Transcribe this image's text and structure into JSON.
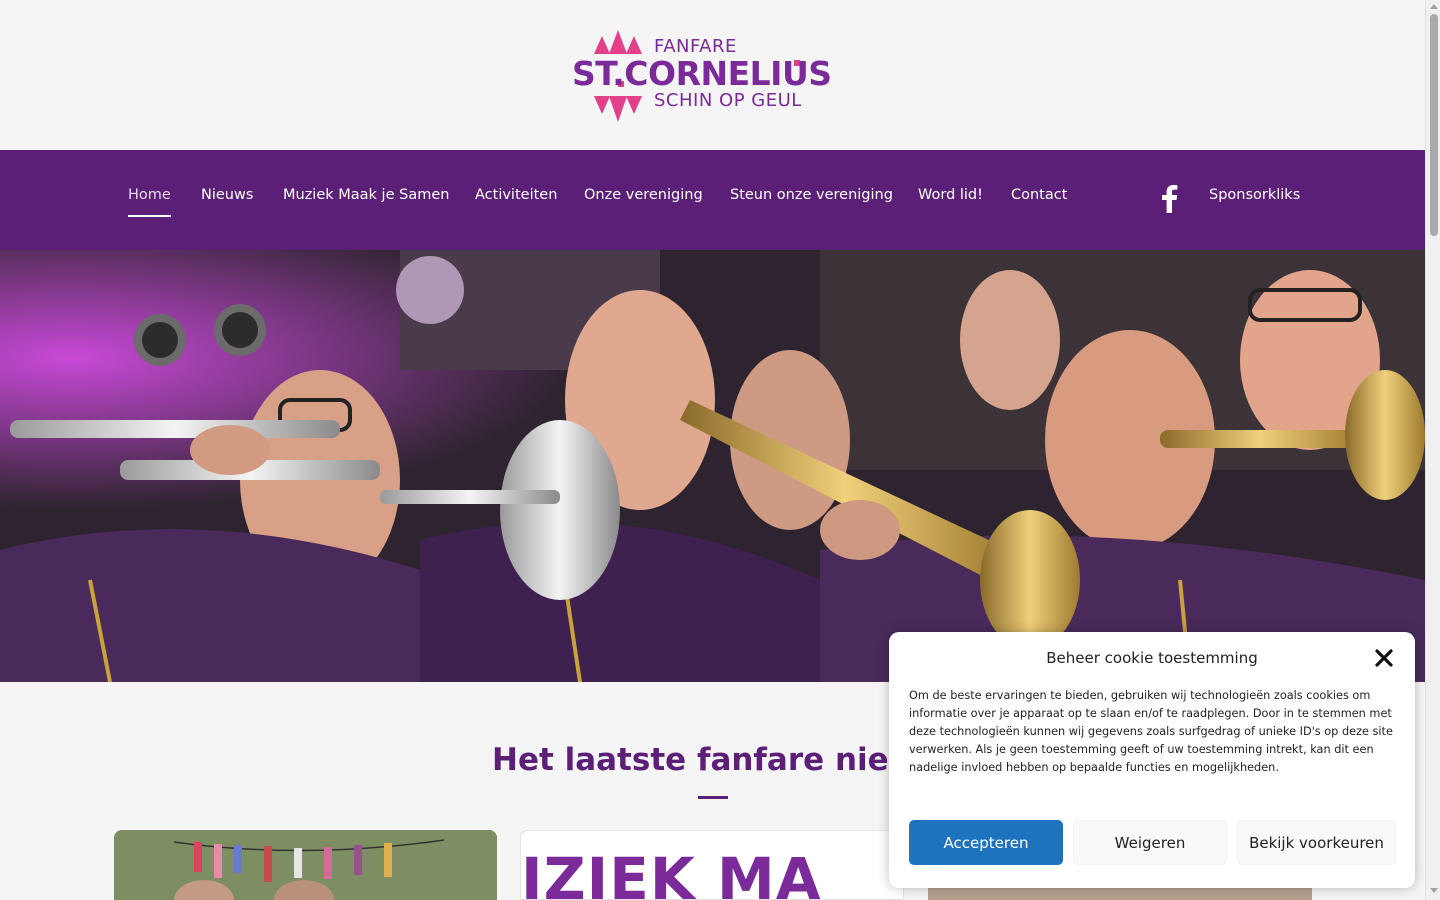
{
  "logo": {
    "top_text": "FANFARE",
    "main_text": "ST.CORNELIUS",
    "bottom_text": "SCHIN OP GEUL",
    "colors": {
      "purple": "#7b2a99",
      "pink": "#e2418a"
    }
  },
  "nav": {
    "background": "#5b1f78",
    "items": [
      {
        "label": "Home",
        "active": true
      },
      {
        "label": "Nieuws"
      },
      {
        "label": "Muziek Maak je Samen"
      },
      {
        "label": "Activiteiten"
      },
      {
        "label": "Onze vereniging"
      },
      {
        "label": "Steun onze vereniging"
      },
      {
        "label": "Word lid!"
      },
      {
        "label": "Contact"
      }
    ],
    "social_icon": "facebook-icon",
    "sponsor_label": "Sponsorkliks"
  },
  "hero": {
    "icon": "photo-trumpet-players"
  },
  "news": {
    "title": "Het laatste fanfare nieuws",
    "card2_text": "IZIEK MA"
  },
  "cookie": {
    "title": "Beheer cookie toestemming",
    "body": "Om de beste ervaringen te bieden, gebruiken wij technologieën zoals cookies om informatie over je apparaat op te slaan en/of te raadplegen. Door in te stemmen met deze technologieën kunnen wij gegevens zoals surfgedrag of unieke ID's op deze site verwerken. Als je geen toestemming geeft of uw toestemming intrekt, kan dit een nadelige invloed hebben op bepaalde functies en mogelijkheden.",
    "accept": "Accepteren",
    "deny": "Weigeren",
    "preferences": "Bekijk voorkeuren",
    "accent": "#1e73be"
  }
}
